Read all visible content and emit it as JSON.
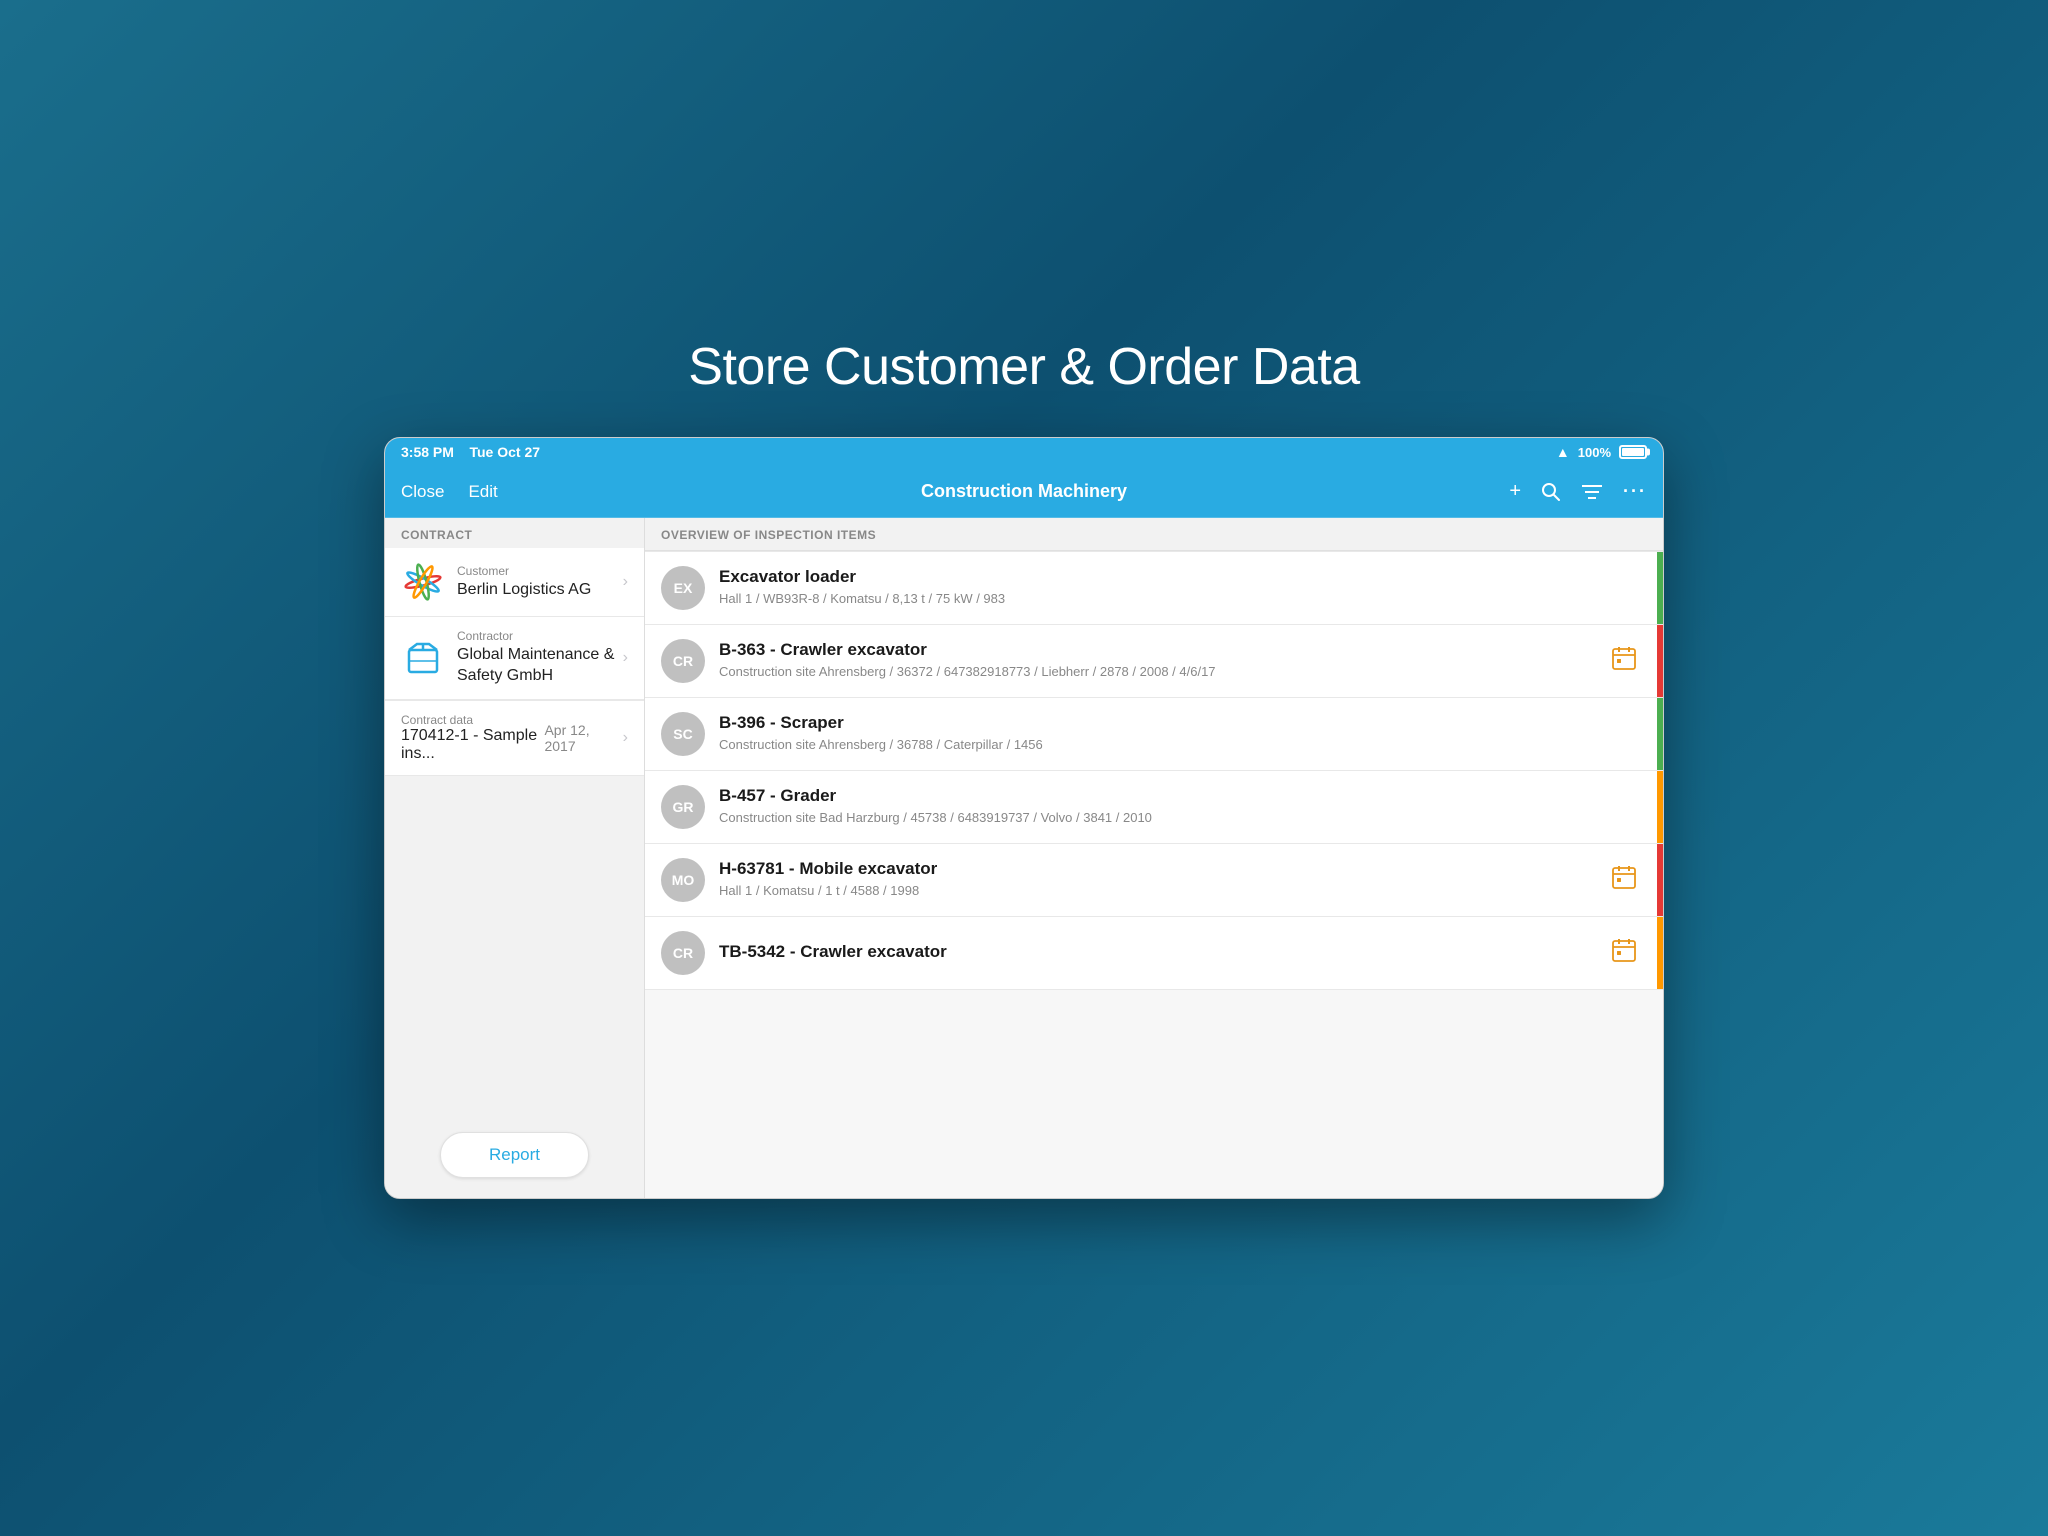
{
  "hero": {
    "title": "Store Customer & Order Data"
  },
  "status_bar": {
    "time": "3:58 PM",
    "date": "Tue Oct 27",
    "battery": "100%"
  },
  "nav": {
    "close_label": "Close",
    "edit_label": "Edit",
    "title": "Construction Machinery",
    "add_icon": "+",
    "search_icon": "🔍",
    "filter_icon": "≡",
    "more_icon": "···"
  },
  "left_panel": {
    "section_label": "CONTRACT",
    "customer": {
      "label": "Customer",
      "value": "Berlin Logistics AG"
    },
    "contractor": {
      "label": "Contractor",
      "value": "Global Maintenance & Safety GmbH"
    },
    "contract_data": {
      "label": "Contract data",
      "id": "170412-1 - Sample ins...",
      "date": "Apr 12, 2017"
    },
    "report_label": "Report"
  },
  "right_panel": {
    "section_label": "OVERVIEW OF INSPECTION ITEMS",
    "items": [
      {
        "avatar": "EX",
        "title": "Excavator loader",
        "subtitle": "Hall 1 / WB93R-8 / Komatsu / 8,13 t / 75 kW / 983",
        "status": "green",
        "has_calendar": false
      },
      {
        "avatar": "CR",
        "title": "B-363 - Crawler excavator",
        "subtitle": "Construction site Ahrensberg / 36372 / 647382918773 / Liebherr / 2878 / 2008 / 4/6/17",
        "status": "red",
        "has_calendar": true
      },
      {
        "avatar": "SC",
        "title": "B-396 - Scraper",
        "subtitle": "Construction site Ahrensberg / 36788 / Caterpillar / 1456",
        "status": "green",
        "has_calendar": false
      },
      {
        "avatar": "GR",
        "title": "B-457 - Grader",
        "subtitle": "Construction site Bad Harzburg / 45738 / 6483919737 / Volvo / 3841 / 2010",
        "status": "orange",
        "has_calendar": false
      },
      {
        "avatar": "MO",
        "title": "H-63781 - Mobile excavator",
        "subtitle": "Hall 1 / Komatsu / 1 t / 4588 / 1998",
        "status": "red",
        "has_calendar": true
      },
      {
        "avatar": "CR",
        "title": "TB-5342 - Crawler excavator",
        "subtitle": "",
        "status": "orange",
        "has_calendar": true
      }
    ]
  }
}
